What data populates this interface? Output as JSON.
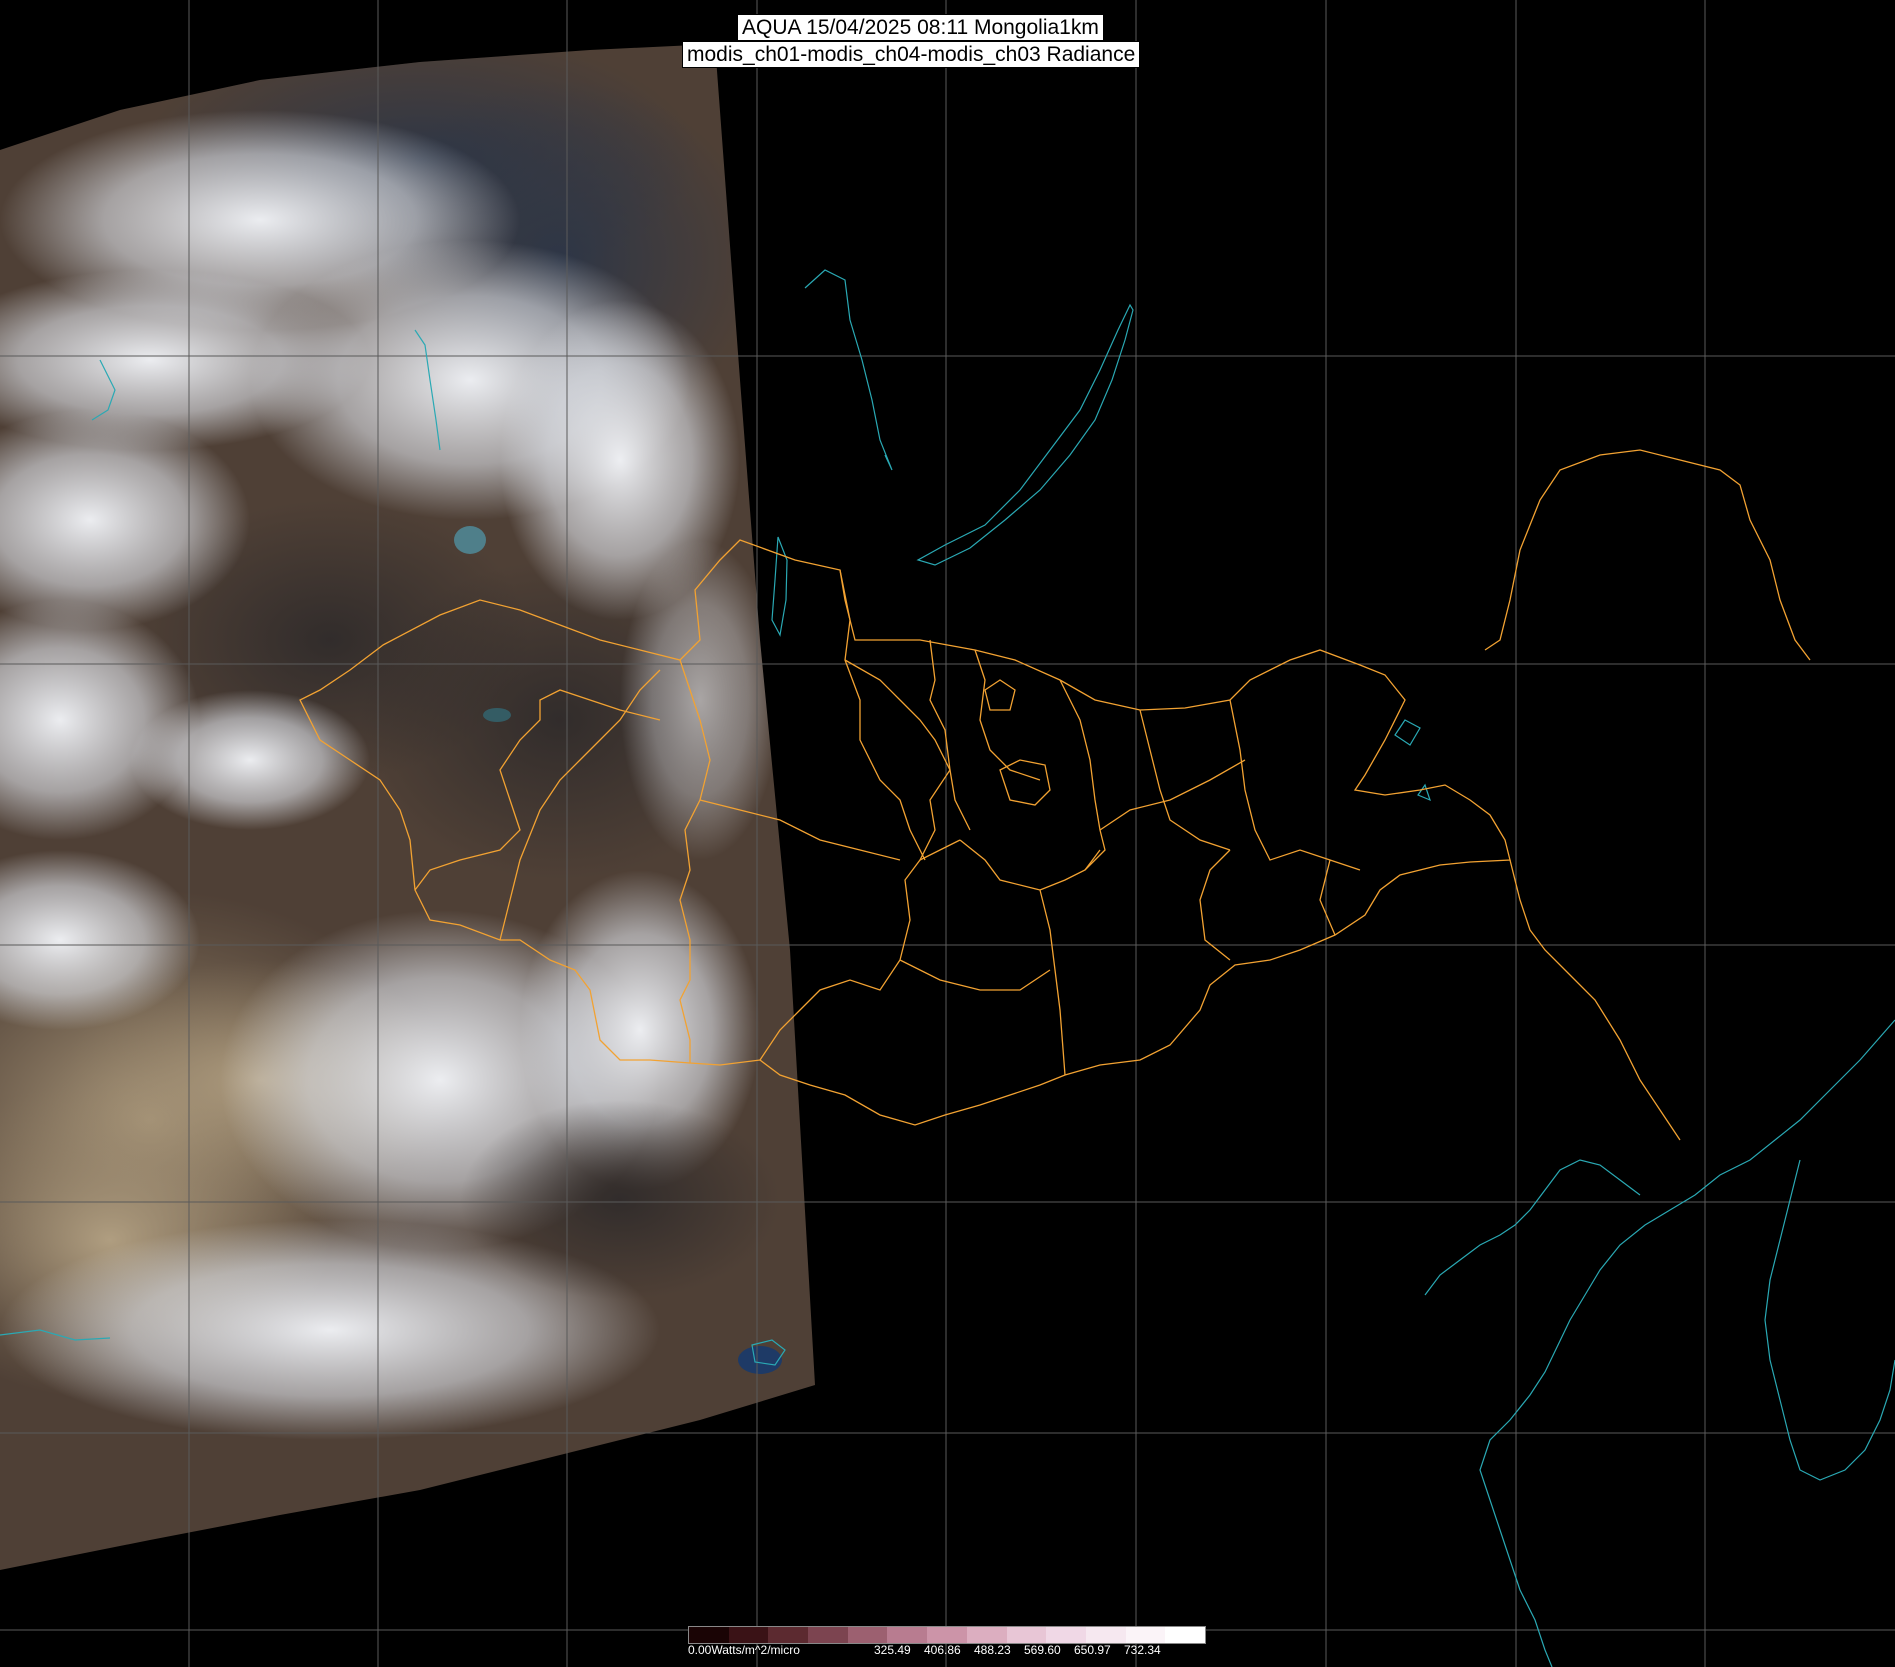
{
  "header": {
    "title_line1": "AQUA 15/04/2025 08:11 Mongolia1km",
    "title_line2": "modis_ch01-modis_ch04-modis_ch03 Radiance"
  },
  "colors": {
    "background": "#000000",
    "grid": "#5a5a5a",
    "coastline": "#2aa9b4",
    "border": "#f2a232",
    "cloud": "#eef0f4",
    "desert": "#a8957a",
    "land": "#4a3b30"
  },
  "colorbar": {
    "unit_label": "0.00Watts/m^2/micro",
    "ticks": [
      "325.49",
      "406.86",
      "488.23",
      "569.60",
      "650.97",
      "732.34"
    ],
    "stops": [
      "#1a0405",
      "#3a1216",
      "#5c2a30",
      "#7c4450",
      "#9c6070",
      "#b87c90",
      "#cc94a8",
      "#dcaec0",
      "#e8c6d6",
      "#f0d8e6",
      "#f6e8f0",
      "#fbf4f8",
      "#ffffff"
    ]
  },
  "icons": [
    "colorbar-legend",
    "map-graticule"
  ]
}
